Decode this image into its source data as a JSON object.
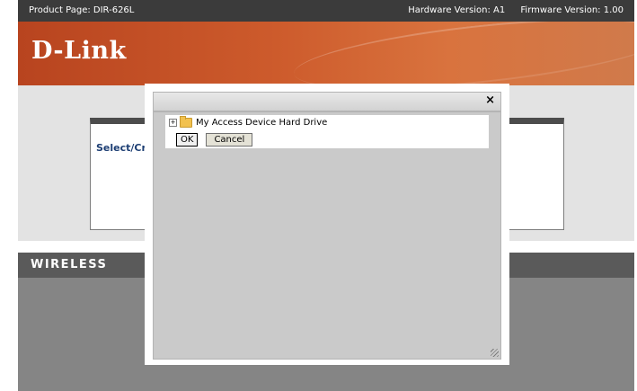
{
  "topbar": {
    "product_page": "Product Page: DIR-626L",
    "hardware_version": "Hardware Version: A1",
    "firmware_version": "Firmware Version: 1.00"
  },
  "banner": {
    "logo_text": "D-Link"
  },
  "card": {
    "title": "Select/Cre"
  },
  "wireless": {
    "label": "WIRELESS"
  },
  "dialog": {
    "close_label": "×",
    "tree": {
      "expander": "+",
      "root_label": "My Access Device Hard Drive"
    },
    "ok_label": "OK",
    "cancel_label": "Cancel"
  },
  "icons": {
    "expander": "plus-box-icon",
    "folder": "folder-icon",
    "close": "close-icon",
    "resize": "resize-grip-icon"
  },
  "colors": {
    "topbar_bg": "#3b3b3b",
    "banner_orange": "#cd5b2c",
    "section_bar": "#5a5a5a",
    "card_title": "#1e3f74",
    "dialog_body": "#cacaca"
  }
}
